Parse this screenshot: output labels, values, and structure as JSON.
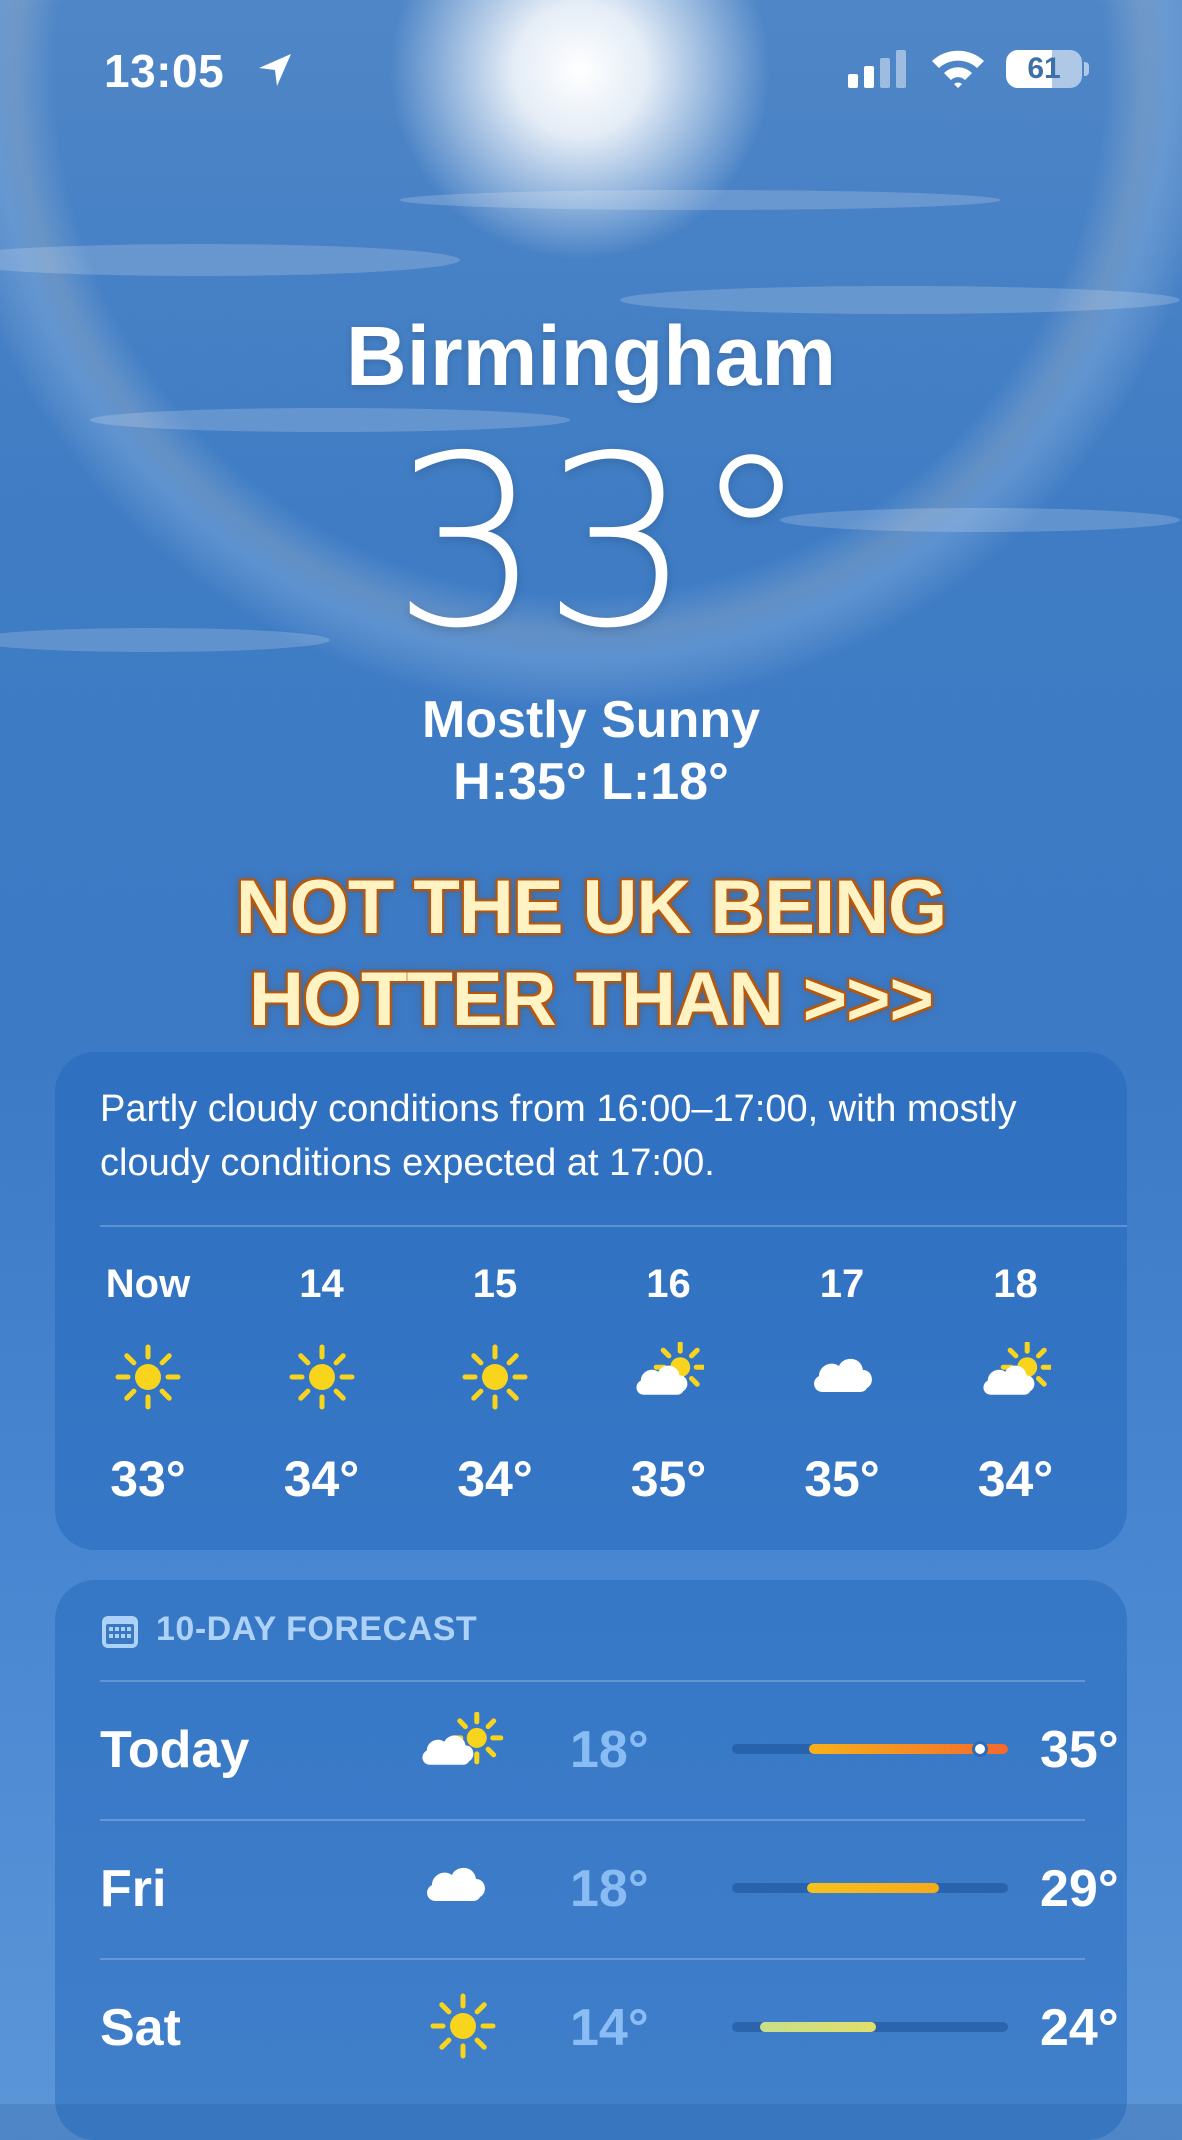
{
  "status_bar": {
    "time": "13:05",
    "battery": "61",
    "battery_level": 0.61
  },
  "location": {
    "city": "Birmingham",
    "temperature": "33°",
    "condition": "Mostly Sunny",
    "high_low": "H:35°  L:18°"
  },
  "overlay_caption": {
    "line1": "NOT THE UK BEING",
    "line2": "HOTTER THAN >>>"
  },
  "hourly": {
    "summary": "Partly cloudy conditions from 16:00–17:00, with mostly cloudy conditions expected at 17:00.",
    "hours": [
      {
        "label": "Now",
        "icon": "sun-icon",
        "temp": "33°"
      },
      {
        "label": "14",
        "icon": "sun-icon",
        "temp": "34°"
      },
      {
        "label": "15",
        "icon": "sun-icon",
        "temp": "34°"
      },
      {
        "label": "16",
        "icon": "partly-cloudy-icon",
        "temp": "35°"
      },
      {
        "label": "17",
        "icon": "cloud-icon",
        "temp": "35°"
      },
      {
        "label": "18",
        "icon": "partly-cloudy-icon",
        "temp": "34°"
      }
    ]
  },
  "daily": {
    "title": "10-DAY FORECAST",
    "days": [
      {
        "name": "Today",
        "icon": "partly-cloudy-icon",
        "low": "18°",
        "high": "35°",
        "range_start": 0.28,
        "range_end": 1.0,
        "current_marker": 0.9,
        "colors": [
          "#f7b21b",
          "#f36a2c"
        ]
      },
      {
        "name": "Fri",
        "icon": "cloud-icon",
        "low": "18°",
        "high": "29°",
        "range_start": 0.27,
        "range_end": 0.75,
        "colors": [
          "#f6c21c",
          "#f7a91b"
        ]
      },
      {
        "name": "Sat",
        "icon": "sun-icon",
        "low": "14°",
        "high": "24°",
        "range_start": 0.1,
        "range_end": 0.52,
        "colors": [
          "#c8df8a",
          "#e2de6a"
        ]
      }
    ]
  },
  "colors": {
    "sun": "#f8d41c",
    "sun_outline": "#f5b800",
    "cloud": "#ffffff"
  }
}
